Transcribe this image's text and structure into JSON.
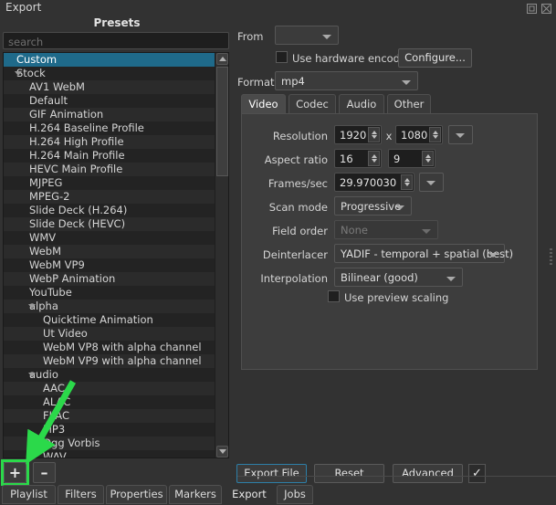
{
  "window": {
    "title": "Export",
    "float_icon": "float-window-icon",
    "close_icon": "close-window-icon"
  },
  "presets": {
    "header": "Presets",
    "search_placeholder": "search",
    "items": [
      {
        "label": "Custom",
        "indent": 0,
        "selected": true,
        "expandable": false
      },
      {
        "label": "Stock",
        "indent": 0,
        "selected": false,
        "expandable": true
      },
      {
        "label": "AV1 WebM",
        "indent": 1,
        "selected": false,
        "expandable": false
      },
      {
        "label": "Default",
        "indent": 1,
        "selected": false,
        "expandable": false
      },
      {
        "label": "GIF Animation",
        "indent": 1,
        "selected": false,
        "expandable": false
      },
      {
        "label": "H.264 Baseline Profile",
        "indent": 1,
        "selected": false,
        "expandable": false
      },
      {
        "label": "H.264 High Profile",
        "indent": 1,
        "selected": false,
        "expandable": false
      },
      {
        "label": "H.264 Main Profile",
        "indent": 1,
        "selected": false,
        "expandable": false
      },
      {
        "label": "HEVC Main Profile",
        "indent": 1,
        "selected": false,
        "expandable": false
      },
      {
        "label": "MJPEG",
        "indent": 1,
        "selected": false,
        "expandable": false
      },
      {
        "label": "MPEG-2",
        "indent": 1,
        "selected": false,
        "expandable": false
      },
      {
        "label": "Slide Deck (H.264)",
        "indent": 1,
        "selected": false,
        "expandable": false
      },
      {
        "label": "Slide Deck (HEVC)",
        "indent": 1,
        "selected": false,
        "expandable": false
      },
      {
        "label": "WMV",
        "indent": 1,
        "selected": false,
        "expandable": false
      },
      {
        "label": "WebM",
        "indent": 1,
        "selected": false,
        "expandable": false
      },
      {
        "label": "WebM VP9",
        "indent": 1,
        "selected": false,
        "expandable": false
      },
      {
        "label": "WebP Animation",
        "indent": 1,
        "selected": false,
        "expandable": false
      },
      {
        "label": "YouTube",
        "indent": 1,
        "selected": false,
        "expandable": false
      },
      {
        "label": "alpha",
        "indent": 1,
        "selected": false,
        "expandable": true
      },
      {
        "label": "Quicktime Animation",
        "indent": 2,
        "selected": false,
        "expandable": false
      },
      {
        "label": "Ut Video",
        "indent": 2,
        "selected": false,
        "expandable": false
      },
      {
        "label": "WebM VP8 with alpha channel",
        "indent": 2,
        "selected": false,
        "expandable": false
      },
      {
        "label": "WebM VP9 with alpha channel",
        "indent": 2,
        "selected": false,
        "expandable": false
      },
      {
        "label": "audio",
        "indent": 1,
        "selected": false,
        "expandable": true
      },
      {
        "label": "AAC",
        "indent": 2,
        "selected": false,
        "expandable": false
      },
      {
        "label": "ALAC",
        "indent": 2,
        "selected": false,
        "expandable": false
      },
      {
        "label": "FLAC",
        "indent": 2,
        "selected": false,
        "expandable": false
      },
      {
        "label": "MP3",
        "indent": 2,
        "selected": false,
        "expandable": false
      },
      {
        "label": "Ogg Vorbis",
        "indent": 2,
        "selected": false,
        "expandable": false
      },
      {
        "label": "WAV",
        "indent": 2,
        "selected": false,
        "expandable": false
      }
    ],
    "add_button": "+",
    "remove_button": "–"
  },
  "annotation": {
    "arrow_color": "#2bd94a",
    "highlight_color": "#2bd94a",
    "target": "add-preset-button"
  },
  "form": {
    "from_label": "From",
    "from_value": "",
    "hardware_encoder_label": "Use hardware encoder",
    "hardware_encoder_checked": false,
    "configure_label": "Configure...",
    "format_label": "Format",
    "format_value": "mp4"
  },
  "tabs": {
    "items": [
      "Video",
      "Codec",
      "Audio",
      "Other"
    ],
    "active": "Video"
  },
  "video": {
    "resolution_label": "Resolution",
    "resolution_width": "1920",
    "resolution_x": "x",
    "resolution_height": "1080",
    "aspect_label": "Aspect ratio",
    "aspect_num": "16",
    "aspect_sep": ":",
    "aspect_den": "9",
    "fps_label": "Frames/sec",
    "fps_value": "29.970030",
    "scan_label": "Scan mode",
    "scan_value": "Progressive",
    "field_label": "Field order",
    "field_value": "None",
    "deinterlacer_label": "Deinterlacer",
    "deinterlacer_value": "YADIF - temporal + spatial (best)",
    "interpolation_label": "Interpolation",
    "interpolation_value": "Bilinear (good)",
    "preview_scaling_label": "Use preview scaling",
    "preview_scaling_checked": false
  },
  "actions": {
    "export_file": "Export File",
    "reset": "Reset",
    "advanced": "Advanced",
    "confirm_icon": "✓"
  },
  "bottom_tabs": {
    "left": [
      "Playlist",
      "Filters",
      "Properties",
      "Markers"
    ],
    "right": [
      "Export",
      "Jobs"
    ],
    "active": "Export"
  }
}
